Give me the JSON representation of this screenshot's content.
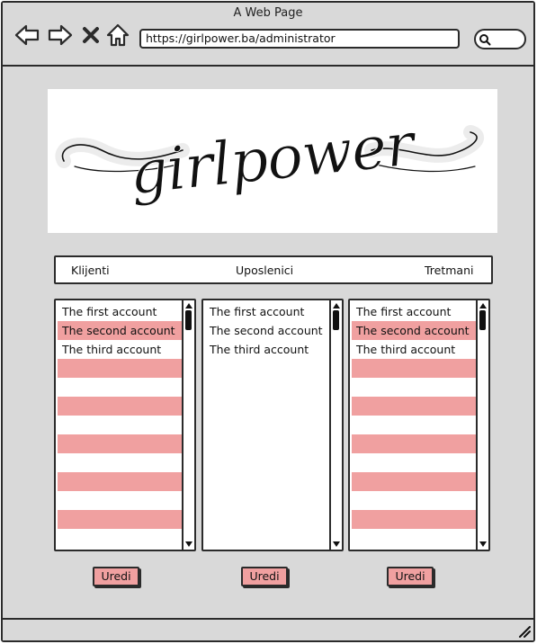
{
  "window": {
    "title": "A Web Page",
    "url": "https://girlpower.ba/administrator"
  },
  "logo": {
    "text": "girlpower"
  },
  "nav": {
    "items": [
      "Klijenti",
      "Uposlenici",
      "Tretmani"
    ]
  },
  "lists": [
    {
      "rows": [
        "The first account",
        "The second account",
        "The third account",
        "",
        "",
        "",
        "",
        "",
        "",
        "",
        "",
        "",
        ""
      ]
    },
    {
      "rows": [
        "The first account",
        "The second account",
        "The third account"
      ]
    },
    {
      "rows": [
        "The first account",
        "The second account",
        "The third account",
        "",
        "",
        "",
        "",
        "",
        "",
        "",
        "",
        "",
        ""
      ]
    }
  ],
  "buttons": {
    "edit_label": "Uredi"
  },
  "colors": {
    "accent": "#f0a0a0",
    "chrome": "#d9d9d9",
    "outline": "#2b2b2b"
  }
}
